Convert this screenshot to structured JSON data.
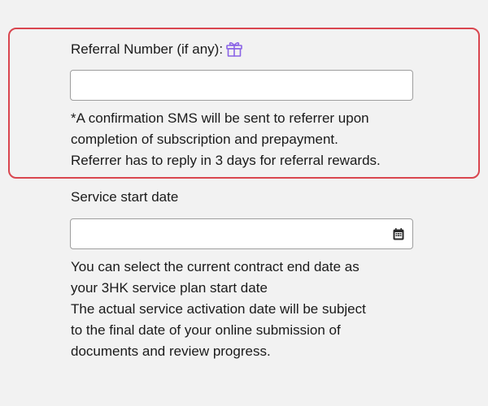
{
  "referral": {
    "label": "Referral Number (if any):",
    "gift_icon": "gift-icon",
    "input_value": "",
    "note_lines": [
      "*A confirmation SMS will be sent to referrer upon",
      "completion of subscription and prepayment.",
      "Referrer has to reply in 3 days for referral rewards."
    ]
  },
  "service_start": {
    "label": "Service start date",
    "input_value": "",
    "calendar_icon": "calendar-icon",
    "note_lines": [
      "You can select the current contract end date as",
      "your 3HK service plan start date",
      "The actual service activation date will be subject",
      "to the final date of your online submission of",
      "documents and review progress."
    ]
  },
  "colors": {
    "highlight_border": "#d9464f",
    "gift_icon": "#8a63e6",
    "background": "#f2f2f2"
  }
}
